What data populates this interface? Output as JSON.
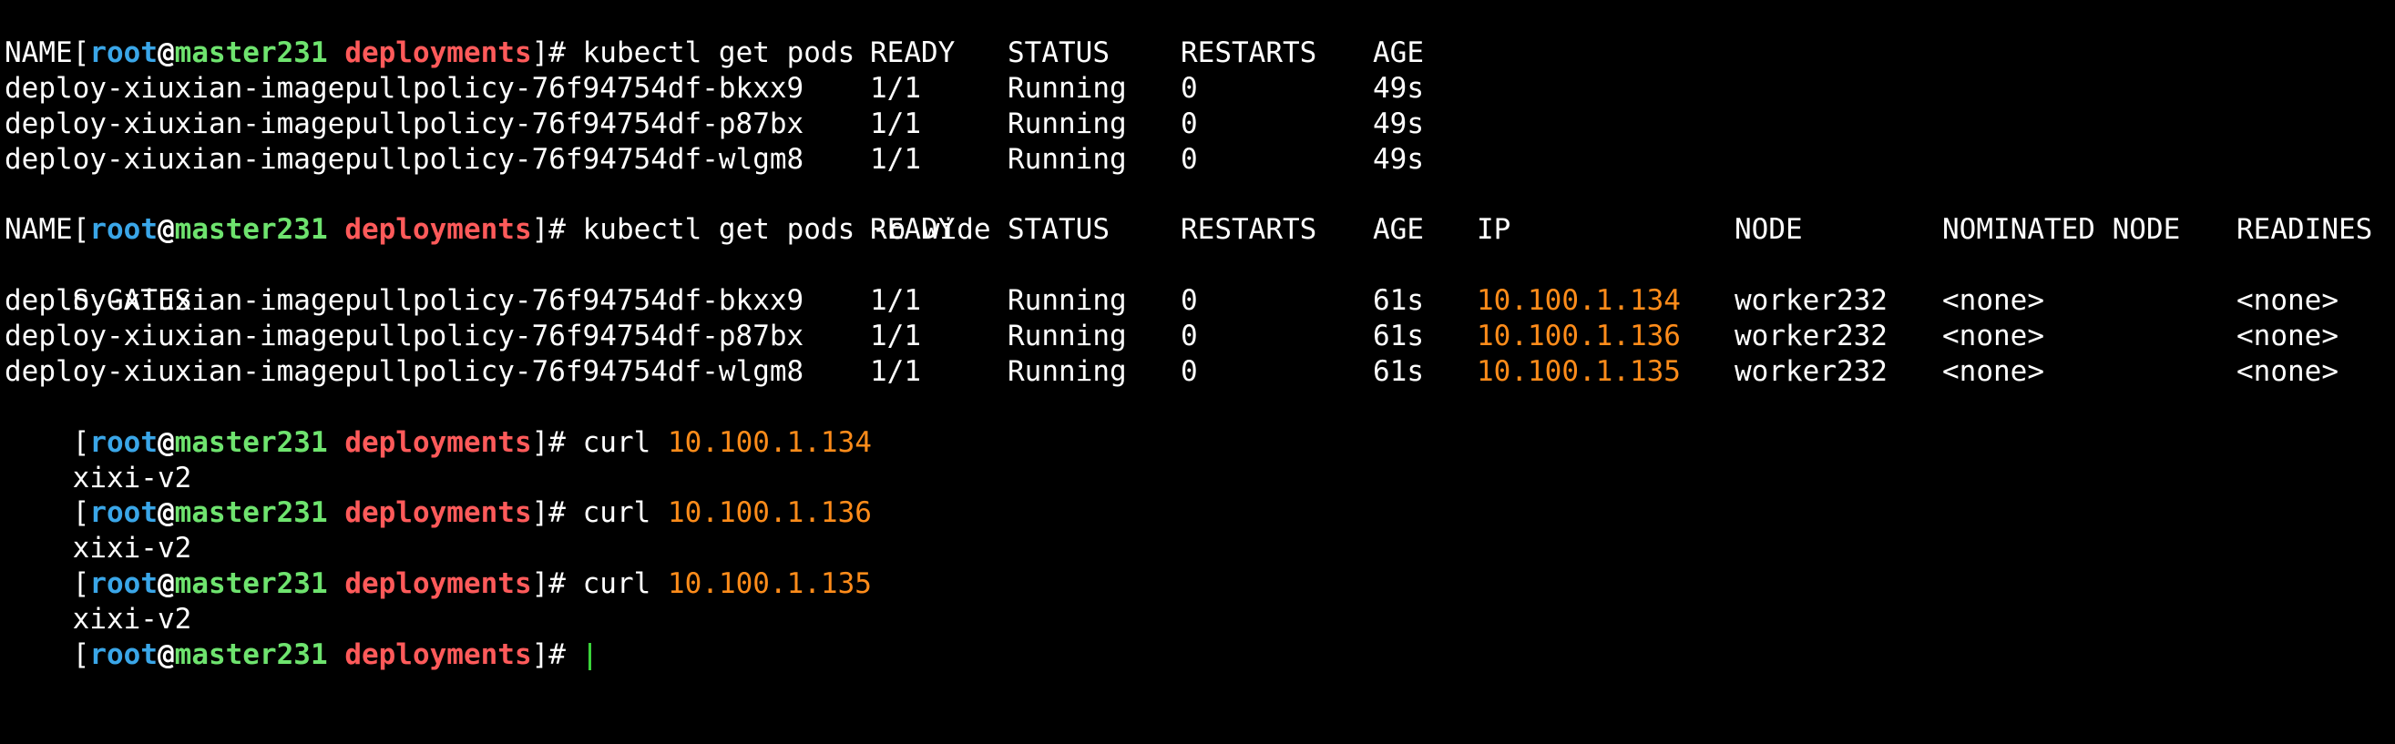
{
  "prompt": {
    "open": "[",
    "user": "root",
    "at": "@",
    "host": "master231",
    "cwd": "deployments",
    "close": "]# "
  },
  "commands": {
    "get_pods": "kubectl get pods",
    "get_pods_wide": "kubectl get pods -o wide",
    "curl": "curl ",
    "curl_ips": [
      "10.100.1.134",
      "10.100.1.136",
      "10.100.1.135"
    ]
  },
  "table1": {
    "headers": [
      "NAME",
      "READY",
      "STATUS",
      "RESTARTS",
      "AGE"
    ],
    "rows": [
      [
        "deploy-xiuxian-imagepullpolicy-76f94754df-bkxx9",
        "1/1",
        "Running",
        "0",
        "49s"
      ],
      [
        "deploy-xiuxian-imagepullpolicy-76f94754df-p87bx",
        "1/1",
        "Running",
        "0",
        "49s"
      ],
      [
        "deploy-xiuxian-imagepullpolicy-76f94754df-wlgm8",
        "1/1",
        "Running",
        "0",
        "49s"
      ]
    ]
  },
  "table2": {
    "headers": [
      "NAME",
      "READY",
      "STATUS",
      "RESTARTS",
      "AGE",
      "IP",
      "NODE",
      "NOMINATED NODE",
      "READINES"
    ],
    "wrap": "S GATES",
    "rows": [
      [
        "deploy-xiuxian-imagepullpolicy-76f94754df-bkxx9",
        "1/1",
        "Running",
        "0",
        "61s",
        "10.100.1.134",
        "worker232",
        "<none>",
        "<none>"
      ],
      [
        "deploy-xiuxian-imagepullpolicy-76f94754df-p87bx",
        "1/1",
        "Running",
        "0",
        "61s",
        "10.100.1.136",
        "worker232",
        "<none>",
        "<none>"
      ],
      [
        "deploy-xiuxian-imagepullpolicy-76f94754df-wlgm8",
        "1/1",
        "Running",
        "0",
        "61s",
        "10.100.1.135",
        "worker232",
        "<none>",
        "<none>"
      ]
    ]
  },
  "curl_output": "xixi-v2",
  "colors": {
    "background": "#000000",
    "text": "#ffffff",
    "user": "#3aa6e8",
    "host": "#6ee36e",
    "cwd": "#ff5a5a",
    "ip": "#ff8c1a",
    "cursor": "#3ad33a"
  }
}
